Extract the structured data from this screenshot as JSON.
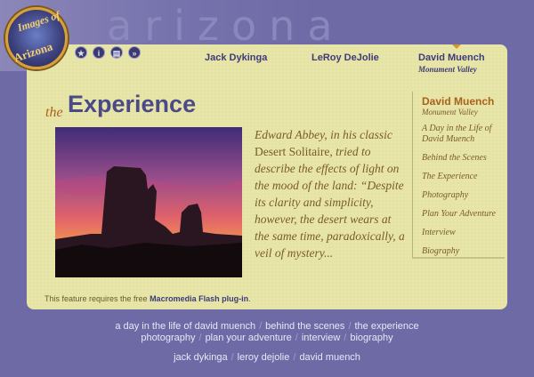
{
  "header": {
    "background_word": "arizona",
    "logo": {
      "top_text": "Images of",
      "bottom_text": "Arizona"
    },
    "icons": [
      "star-icon",
      "info-icon",
      "book-icon",
      "forward-icon"
    ]
  },
  "top_nav": {
    "items": [
      "Jack Dykinga",
      "LeRoy DeJolie",
      "David Muench"
    ],
    "active_sub": "Monument Valley"
  },
  "title": {
    "prefix": "the",
    "main": "Experience"
  },
  "quote": {
    "part1": "Edward Abbey, in his classic ",
    "book": "Desert Solitaire",
    "part2": ", tried to describe the effects of light on the mood of the land: “Despite its clarity and simplicity, however, the desert wears at the same time, paradoxically, a veil of mystery..."
  },
  "sidebar": {
    "name": "David Muench",
    "sub": "Monument Valley",
    "items": [
      "A Day in the Life of David Muench",
      "Behind the Scenes",
      "The Experience",
      "Photography",
      "Plan Your Adventure",
      "Interview",
      "Biography"
    ]
  },
  "flash": {
    "text": "This feature requires the free ",
    "link": "Macromedia Flash plug-in",
    "end": "."
  },
  "footer": {
    "row1": [
      "a day in the life of david muench",
      "behind the scenes",
      "the experience"
    ],
    "row2": [
      "photography",
      "plan your adventure",
      "interview",
      "biography"
    ],
    "row3": [
      "jack dykinga",
      "leroy dejolie",
      "david muench"
    ],
    "separator": "/"
  },
  "colors": {
    "background": "#6d6aa6",
    "panel": "#e6e4a4",
    "accent": "#a9611e",
    "nav": "#3d3b7a"
  }
}
